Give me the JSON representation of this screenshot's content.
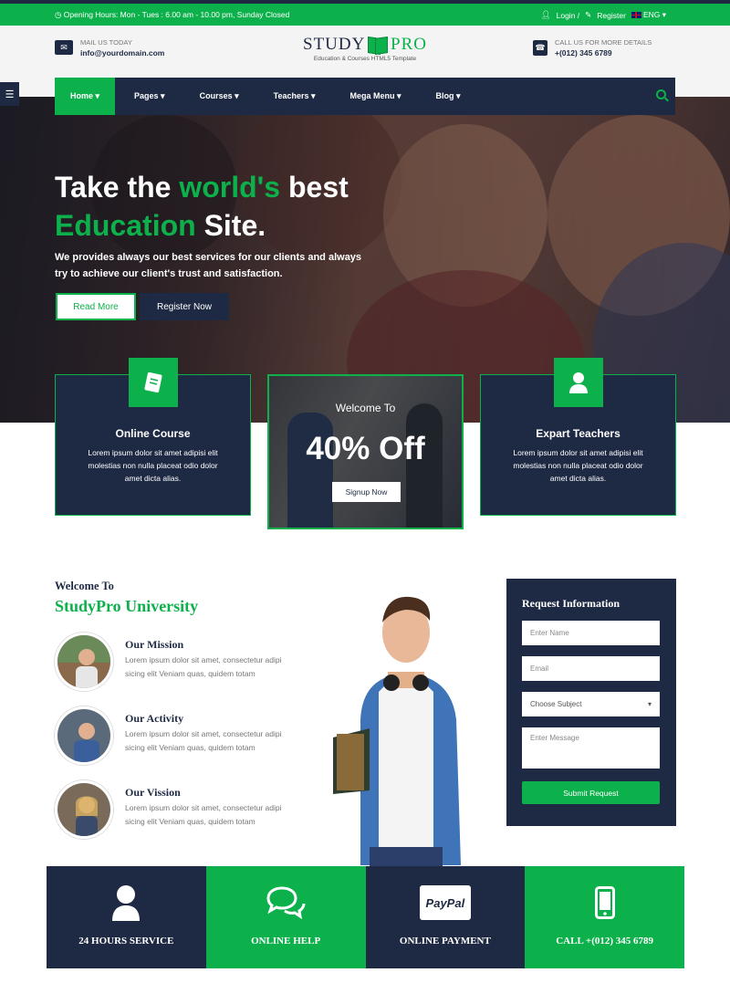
{
  "topbar": {
    "hours": "Opening Hours: Mon - Tues : 6.00 am - 10.00 pm, Sunday Closed",
    "login": "Login /",
    "register": "Register",
    "language": "ENG"
  },
  "header": {
    "mail_label": "MAIL US TODAY",
    "mail_value": "info@yourdomain.com",
    "call_label": "CALL US FOR MORE DETAILS",
    "call_value": "+(012) 345 6789",
    "logo_left": "STUDY",
    "logo_right": "PRO",
    "logo_tagline": "Education & Courses HTML5 Template"
  },
  "nav": {
    "items": [
      {
        "label": "Home ▾"
      },
      {
        "label": "Pages ▾"
      },
      {
        "label": "Courses ▾"
      },
      {
        "label": "Teachers ▾"
      },
      {
        "label": "Mega Menu ▾"
      },
      {
        "label": "Blog ▾"
      }
    ],
    "active_index": 0
  },
  "hero": {
    "title_1": "Take the ",
    "title_2": "world's",
    "title_3": " best",
    "title_4": "Education",
    "title_5": " Site.",
    "text": "We provides always our best services for our clients and always try to achieve our client's trust and satisfaction.",
    "read_more": "Read More",
    "register_now": "Register Now"
  },
  "cards": {
    "online_course": {
      "title": "Online Course",
      "text": "Lorem ipsum dolor sit amet adipisi elit molestias non nulla placeat odio dolor amet dicta alias."
    },
    "promo": {
      "welcome": "Welcome To",
      "offer": "40% Off",
      "button": "Signup Now"
    },
    "teachers": {
      "title": "Expart Teachers",
      "text": "Lorem ipsum dolor sit amet adipisi elit molestias non nulla placeat odio dolor amet dicta alias."
    }
  },
  "about": {
    "welcome": "Welcome To",
    "title": "StudyPro University",
    "features": [
      {
        "title": "Our Mission",
        "text": "Lorem ipsum dolor sit amet, consectetur adipi sicing elit Veniam quas, quidem totam"
      },
      {
        "title": "Our Activity",
        "text": "Lorem ipsum dolor sit amet, consectetur adipi sicing elit Veniam quas, quidem totam"
      },
      {
        "title": "Our Vission",
        "text": "Lorem ipsum dolor sit amet, consectetur adipi sicing elit Veniam quas, quidem totam"
      }
    ]
  },
  "form": {
    "title": "Request Information",
    "name_placeholder": "Enter Name",
    "email_placeholder": "Email",
    "subject_value": "Choose Subject",
    "message_placeholder": "Enter Message",
    "submit": "Submit Request"
  },
  "services": [
    {
      "label": "24 HOURS SERVICE",
      "icon": "user-icon"
    },
    {
      "label": "ONLINE HELP",
      "icon": "chat-icon"
    },
    {
      "label": "ONLINE PAYMENT",
      "icon": "paypal-icon",
      "icon_text": "PayPal"
    },
    {
      "label": "CALL +(012) 345 6789",
      "icon": "phone-icon"
    }
  ],
  "colors": {
    "brand_green": "#0db14b",
    "navy": "#1e2a44"
  }
}
